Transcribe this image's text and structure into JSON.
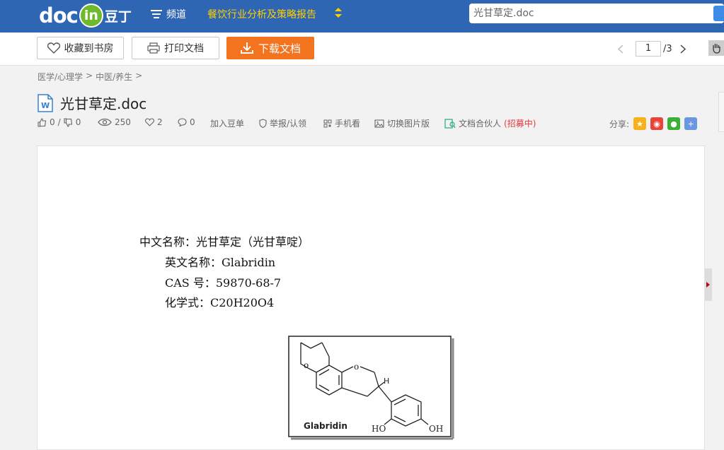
{
  "header": {
    "logo_doc": "doc",
    "logo_in": "in",
    "logo_cn": "豆丁",
    "channel_label": "频道",
    "report_label": "餐饮行业分析及策略报告",
    "search_value": "光甘草定.doc"
  },
  "toolbar": {
    "collect_label": "收藏到书房",
    "print_label": "打印文档",
    "download_label": "下载文档",
    "page_current": "1",
    "page_total": "/3"
  },
  "breadcrumb": [
    "医学/心理学",
    ">",
    "中医/养生",
    ">"
  ],
  "doc": {
    "title": "光甘草定.doc",
    "likes": "0",
    "separator": "/",
    "dislikes": "0",
    "views": "250",
    "favorites": "2",
    "comments": "0",
    "add_label": "加入豆单",
    "report_label": "举报/认领",
    "mobile_label": "手机看",
    "switch_label": "切换图片版",
    "partner_label": "文档合伙人",
    "partner_hint": "(招募中)",
    "share_label": "分享:"
  },
  "page_content": {
    "line1": "中文名称：光甘草定（光甘草啶）",
    "line2": "英文名称：Glabridin",
    "line3": "CAS 号：59870-68-7",
    "line4": "化学式：C20H20O4",
    "figure_label": "Glabridin",
    "figure_h": "H",
    "figure_ho": "HO",
    "figure_oh": "OH"
  },
  "colors": {
    "topbar": "#2f66b3",
    "download": "#f4731f",
    "report_text": "#ffd000"
  }
}
